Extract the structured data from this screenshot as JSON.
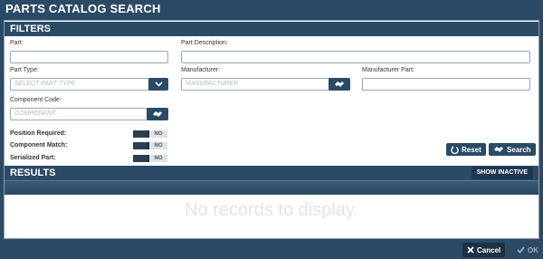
{
  "window": {
    "title": "PARTS CATALOG SEARCH"
  },
  "filters": {
    "header": "FILTERS",
    "part": {
      "label": "Part:",
      "value": ""
    },
    "part_description": {
      "label": "Part Description:",
      "value": ""
    },
    "part_type": {
      "label": "Part Type:",
      "placeholder": "SELECT PART TYPE"
    },
    "manufacturer": {
      "label": "Manufacturer:",
      "placeholder": "MANUFACTURER"
    },
    "manufacturer_part": {
      "label": "Manufacturer Part:",
      "value": ""
    },
    "component_code": {
      "label": "Component Code:",
      "placeholder": "COMPONENT"
    },
    "toggles": [
      {
        "label": "Position Required:",
        "state": "NO"
      },
      {
        "label": "Component Match:",
        "state": "NO"
      },
      {
        "label": "Serialized Part:",
        "state": "NO"
      }
    ],
    "reset_label": "Reset",
    "search_label": "Search"
  },
  "results": {
    "header": "RESULTS",
    "show_inactive_label": "SHOW INACTIVE",
    "empty_message": "No records to display."
  },
  "footer": {
    "cancel_label": "Cancel",
    "ok_label": "OK"
  }
}
